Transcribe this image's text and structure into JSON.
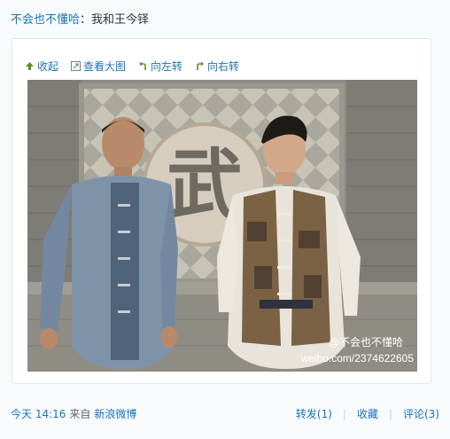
{
  "post": {
    "author": "不会也不懂哈",
    "colon": "：",
    "text": "我和王今铎"
  },
  "toolbar": {
    "collapse": "收起",
    "view_large": "查看大图",
    "rotate_left": "向左转",
    "rotate_right": "向右转"
  },
  "photo": {
    "watermark_name": "@不会也不懂哈",
    "watermark_url": "weibo.com/2374622605",
    "wall_sign": "武"
  },
  "footer": {
    "time": "今天 14:16",
    "source_prefix": "来自",
    "source": "新浪微博",
    "repost": "转发(1)",
    "favorite": "收藏",
    "comment": "评论(3)",
    "separator": "|"
  },
  "colors": {
    "link": "#1c73b8",
    "background": "#f7fbfe",
    "card_border": "#dce8f1"
  }
}
